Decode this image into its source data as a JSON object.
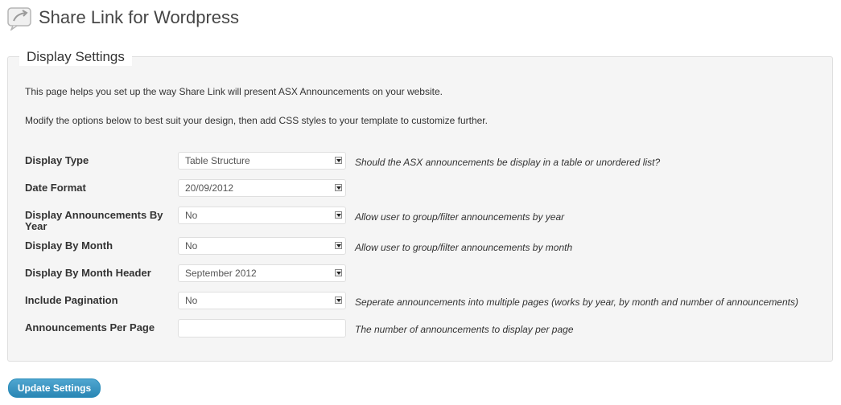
{
  "header": {
    "title": "Share Link for Wordpress",
    "icon": "share-link-icon"
  },
  "fieldset": {
    "legend": "Display Settings",
    "intro": [
      "This page helps you set up the way Share Link will present ASX Announcements on your website.",
      "Modify the options below to best suit your design, then add CSS styles to your template to customize further."
    ],
    "rows": [
      {
        "label": "Display Type",
        "value": "Table Structure",
        "hint": "Should the ASX announcements be display in a table or unordered list?"
      },
      {
        "label": "Date Format",
        "value": "20/09/2012",
        "hint": ""
      },
      {
        "label": "Display Announcements By Year",
        "value": "No",
        "hint": "Allow user to group/filter announcements by year"
      },
      {
        "label": "Display By Month",
        "value": "No",
        "hint": "Allow user to group/filter announcements by month"
      },
      {
        "label": "Display By Month Header",
        "value": "September 2012",
        "hint": ""
      },
      {
        "label": "Include Pagination",
        "value": "No",
        "hint": "Seperate announcements into multiple pages (works by year, by month and number of announcements)"
      },
      {
        "label": "Announcements Per Page",
        "value": "",
        "hint": "The number of announcements to display per page"
      }
    ]
  },
  "actions": {
    "update_label": "Update Settings"
  },
  "colors": {
    "primary_button": "#2a86b4",
    "panel_bg": "#f5f5f5",
    "border": "#dfdfdf"
  }
}
